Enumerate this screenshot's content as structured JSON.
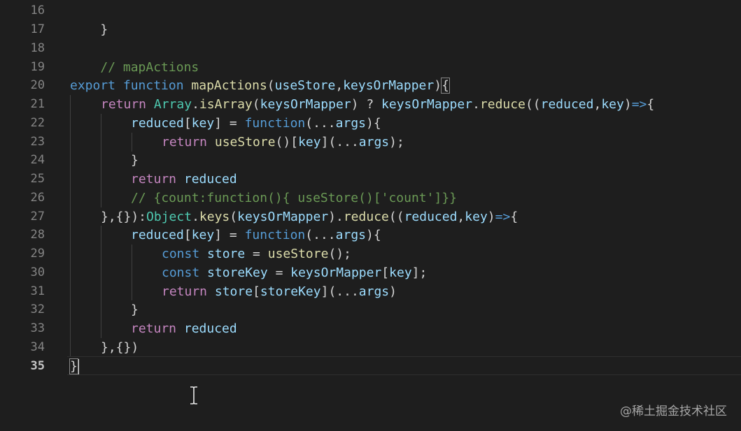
{
  "editor": {
    "line_numbers": [
      "16",
      "17",
      "18",
      "19",
      "20",
      "21",
      "22",
      "23",
      "24",
      "25",
      "26",
      "27",
      "28",
      "29",
      "30",
      "31",
      "32",
      "33",
      "34",
      "35"
    ],
    "lines": {
      "l16": {
        "t1": "}"
      },
      "l18": {
        "t1": "// mapActions"
      },
      "l20": {
        "t1": "export",
        "t2": " ",
        "t3": "function",
        "t4": " ",
        "t5": "mapActions",
        "t6": "(",
        "t7": "useStore",
        "t8": ",",
        "t9": "keysOrMapper",
        "t10": ")",
        "t11": "{"
      },
      "l21": {
        "t1": "return",
        "t2": " ",
        "t3": "Array",
        "t4": ".",
        "t5": "isArray",
        "t6": "(",
        "t7": "keysOrMapper",
        "t8": ") ? ",
        "t9": "keysOrMapper",
        "t10": ".",
        "t11": "reduce",
        "t12": "((",
        "t13": "reduced",
        "t14": ",",
        "t15": "key",
        "t16": ")",
        "t17": "=>",
        "t18": "{"
      },
      "l22": {
        "t1": "reduced",
        "t2": "[",
        "t3": "key",
        "t4": "] = ",
        "t5": "function",
        "t6": "(...",
        "t7": "args",
        "t8": "){"
      },
      "l23": {
        "t1": "return",
        "t2": " ",
        "t3": "useStore",
        "t4": "()[",
        "t5": "key",
        "t6": "](...",
        "t7": "args",
        "t8": ");"
      },
      "l24": {
        "t1": "}"
      },
      "l25": {
        "t1": "return",
        "t2": " ",
        "t3": "reduced"
      },
      "l26": {
        "t1": "// {count:function(){ useStore()['count']}}"
      },
      "l27": {
        "t1": "},{}):",
        "t2": "Object",
        "t3": ".",
        "t4": "keys",
        "t5": "(",
        "t6": "keysOrMapper",
        "t7": ").",
        "t8": "reduce",
        "t9": "((",
        "t10": "reduced",
        "t11": ",",
        "t12": "key",
        "t13": ")",
        "t14": "=>",
        "t15": "{"
      },
      "l28": {
        "t1": "reduced",
        "t2": "[",
        "t3": "key",
        "t4": "] = ",
        "t5": "function",
        "t6": "(...",
        "t7": "args",
        "t8": "){"
      },
      "l29": {
        "t1": "const",
        "t2": " ",
        "t3": "store",
        "t4": " = ",
        "t5": "useStore",
        "t6": "();"
      },
      "l30": {
        "t1": "const",
        "t2": " ",
        "t3": "storeKey",
        "t4": " = ",
        "t5": "keysOrMapper",
        "t6": "[",
        "t7": "key",
        "t8": "];"
      },
      "l31": {
        "t1": "return",
        "t2": " ",
        "t3": "store",
        "t4": "[",
        "t5": "storeKey",
        "t6": "](...",
        "t7": "args",
        "t8": ")"
      },
      "l32": {
        "t1": "}"
      },
      "l33": {
        "t1": "return",
        "t2": " ",
        "t3": "reduced"
      },
      "l34": {
        "t1": "},{})"
      },
      "l35": {
        "t1": "}"
      }
    }
  },
  "watermark": {
    "text": "@稀土掘金技术社区"
  },
  "icons": {
    "mouse_cursor": "text-ibeam-icon"
  }
}
